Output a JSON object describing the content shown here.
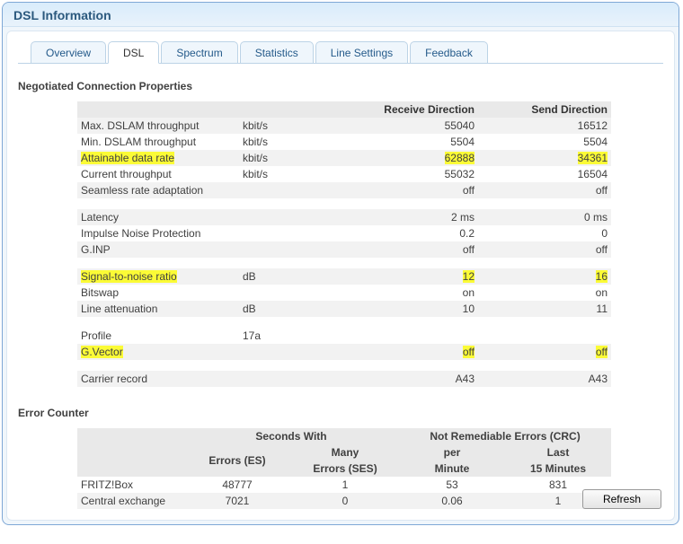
{
  "panel_title": "DSL Information",
  "tabs": [
    "Overview",
    "DSL",
    "Spectrum",
    "Statistics",
    "Line Settings",
    "Feedback"
  ],
  "active_tab": 1,
  "section1_title": "Negotiated Connection Properties",
  "section2_title": "Error Counter",
  "col_headers": {
    "recv": "Receive Direction",
    "send": "Send Direction"
  },
  "rows": [
    {
      "label": "Max. DSLAM throughput",
      "unit": "kbit/s",
      "recv": "55040",
      "send": "16512",
      "odd": true
    },
    {
      "label": "Min. DSLAM throughput",
      "unit": "kbit/s",
      "recv": "5504",
      "send": "5504",
      "odd": false
    },
    {
      "label": "Attainable data rate",
      "unit": "kbit/s",
      "recv": "62888",
      "send": "34361",
      "odd": true,
      "hl_label": true,
      "hl_recv": true,
      "hl_send": true
    },
    {
      "label": "Current throughput",
      "unit": "kbit/s",
      "recv": "55032",
      "send": "16504",
      "odd": false
    },
    {
      "label": "Seamless rate adaptation",
      "unit": "",
      "recv": "off",
      "send": "off",
      "odd": true
    },
    {
      "spacer": true
    },
    {
      "label": "Latency",
      "unit": "",
      "recv": "2 ms",
      "send": "0 ms",
      "odd": true
    },
    {
      "label": "Impulse Noise Protection",
      "unit": "",
      "recv": "0.2",
      "send": "0",
      "odd": false
    },
    {
      "label": "G.INP",
      "unit": "",
      "recv": "off",
      "send": "off",
      "odd": true
    },
    {
      "spacer": true
    },
    {
      "label": "Signal-to-noise ratio",
      "unit": "dB",
      "recv": "12",
      "send": "16",
      "odd": true,
      "hl_label": true,
      "hl_recv": true,
      "hl_send": true
    },
    {
      "label": "Bitswap",
      "unit": "",
      "recv": "on",
      "send": "on",
      "odd": false
    },
    {
      "label": "Line attenuation",
      "unit": "dB",
      "recv": "10",
      "send": "11",
      "odd": true
    },
    {
      "spacer": true
    },
    {
      "label": "Profile",
      "unit": "17a",
      "recv": "",
      "send": "",
      "odd": false
    },
    {
      "label": "G.Vector",
      "unit": "",
      "recv": "off",
      "send": "off",
      "odd": true,
      "hl_label": true,
      "hl_recv": true,
      "hl_send": true
    },
    {
      "spacer": true
    },
    {
      "label": "Carrier record",
      "unit": "",
      "recv": "A43",
      "send": "A43",
      "odd": true
    }
  ],
  "error_headers": {
    "group_seconds": "Seconds With",
    "group_nre": "Not Remediable Errors (CRC)",
    "es": "Errors (ES)",
    "ses_top": "Many",
    "ses_bot": "Errors (SES)",
    "pm_top": "per",
    "pm_bot": "Minute",
    "l15_top": "Last",
    "l15_bot": "15 Minutes"
  },
  "error_rows": [
    {
      "label": "FRITZ!Box",
      "es": "48777",
      "ses": "1",
      "pm": "53",
      "l15": "831",
      "odd": false
    },
    {
      "label": "Central exchange",
      "es": "7021",
      "ses": "0",
      "pm": "0.06",
      "l15": "1",
      "odd": true
    }
  ],
  "refresh_label": "Refresh"
}
